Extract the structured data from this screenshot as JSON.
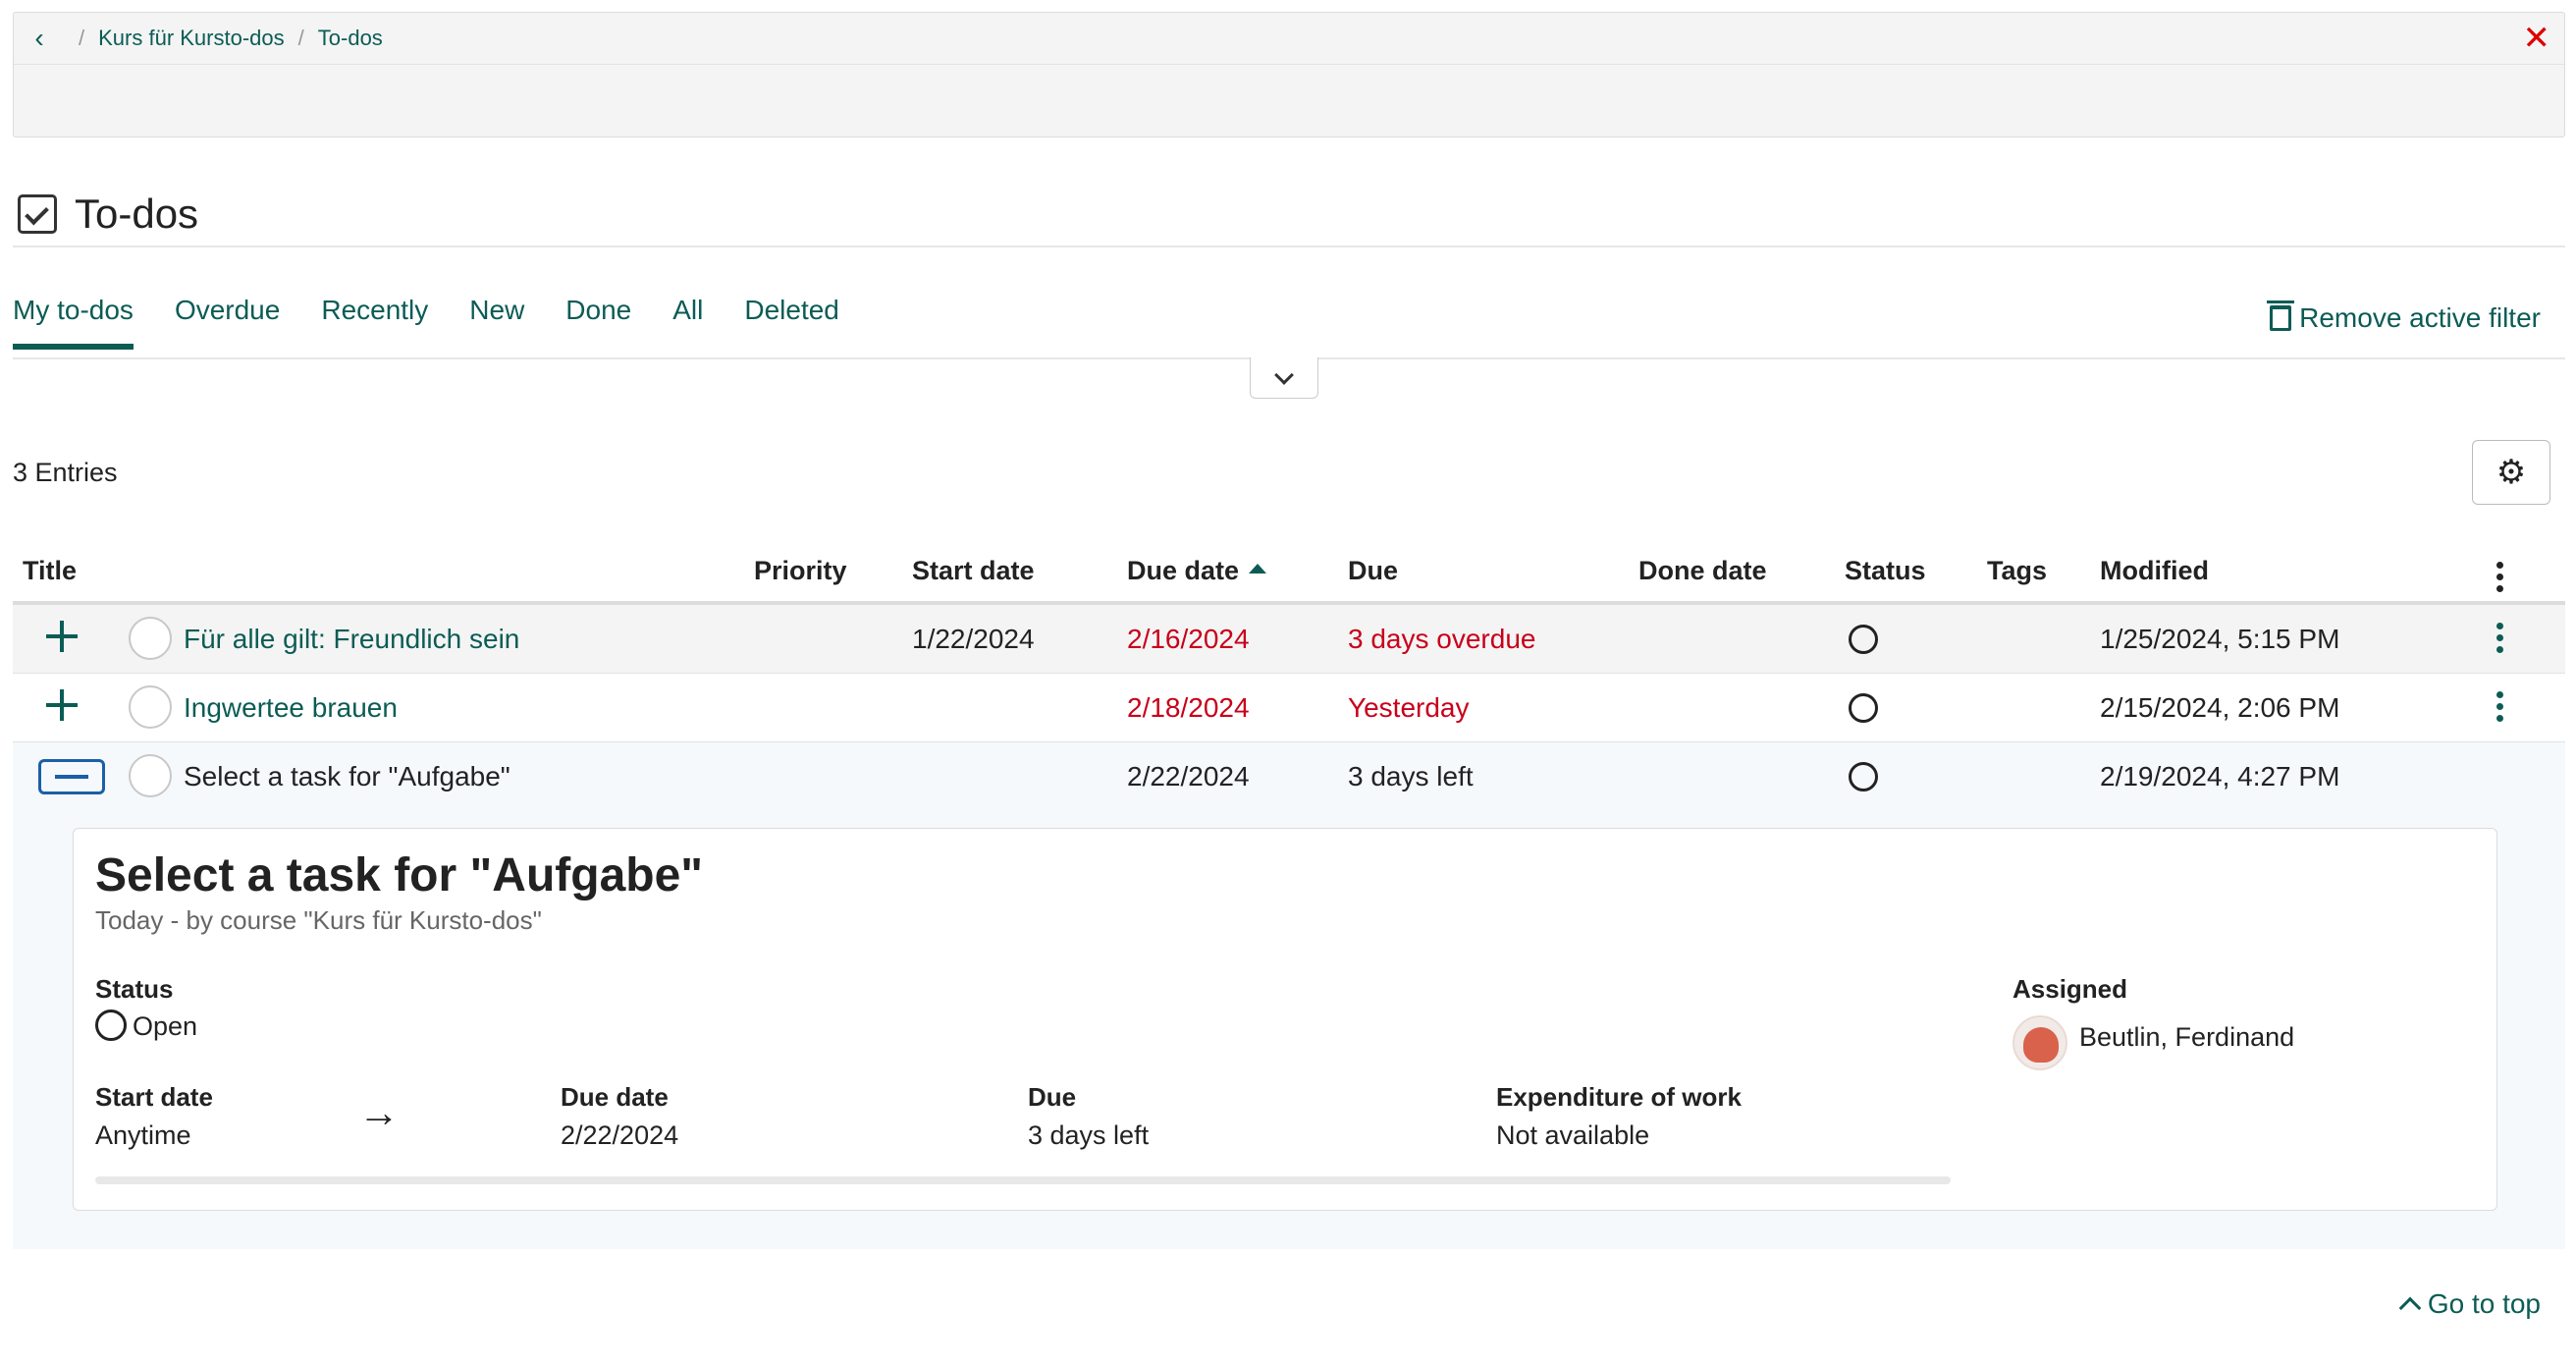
{
  "breadcrumb": {
    "back_icon": "chevron-left-icon",
    "items": [
      "Kurs für Kursto-dos",
      "To-dos"
    ],
    "close_icon": "close-icon"
  },
  "page_title": "To-dos",
  "tabs": [
    "My to-dos",
    "Overdue",
    "Recently",
    "New",
    "Done",
    "All",
    "Deleted"
  ],
  "active_tab": "My to-dos",
  "remove_filter_label": "Remove active filter",
  "entries_count": "3 Entries",
  "table": {
    "columns": [
      "Title",
      "Priority",
      "Start date",
      "Due date",
      "Due",
      "Done date",
      "Status",
      "Tags",
      "Modified"
    ],
    "sorted_column": "Due date",
    "rows": [
      {
        "title": "Für alle gilt: Freundlich sein",
        "priority": "",
        "start_date": "1/22/2024",
        "due_date": "2/16/2024",
        "due": "3 days overdue",
        "done_date": "",
        "status_icon": "circle-open-icon",
        "tags": "",
        "modified": "1/25/2024, 5:15 PM",
        "overdue": true
      },
      {
        "title": "Ingwertee brauen",
        "priority": "",
        "start_date": "",
        "due_date": "2/18/2024",
        "due": "Yesterday",
        "done_date": "",
        "status_icon": "circle-open-icon",
        "tags": "",
        "modified": "2/15/2024, 2:06 PM",
        "overdue": true
      },
      {
        "title": "Select a task for \"Aufgabe\"",
        "priority": "",
        "start_date": "",
        "due_date": "2/22/2024",
        "due": "3 days left",
        "done_date": "",
        "status_icon": "circle-open-icon",
        "tags": "",
        "modified": "2/19/2024, 4:27 PM",
        "overdue": false
      }
    ]
  },
  "detail": {
    "title": "Select a task for \"Aufgabe\"",
    "subtitle": "Today - by course \"Kurs für Kursto-dos\"",
    "status_label": "Status",
    "status_value": "Open",
    "start_label": "Start date",
    "start_value": "Anytime",
    "due_date_label": "Due date",
    "due_date_value": "2/22/2024",
    "due_label": "Due",
    "due_value": "3 days left",
    "work_label": "Expenditure of work",
    "work_value": "Not available",
    "assigned_label": "Assigned",
    "assigned_name": "Beutlin, Ferdinand"
  },
  "go_to_top": "Go to top",
  "colors": {
    "accent": "#0b5c55",
    "overdue": "#c8001a",
    "close": "#dd0000"
  }
}
